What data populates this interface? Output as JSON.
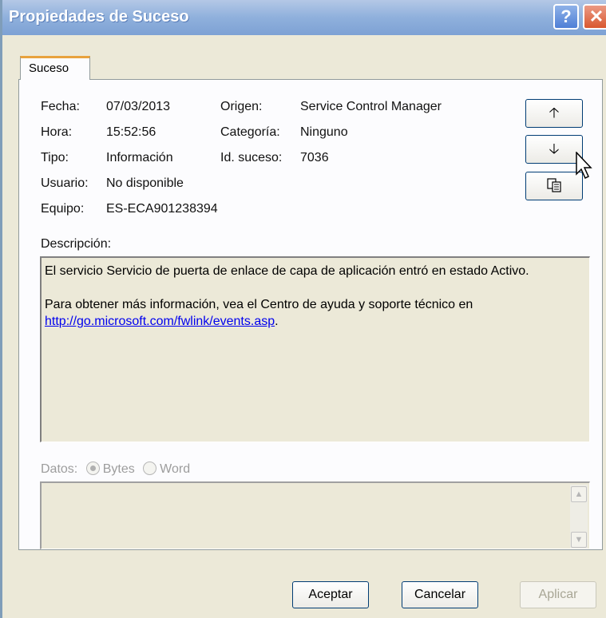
{
  "window": {
    "title": "Propiedades de Suceso",
    "help_label": "?",
    "close_label": "✕"
  },
  "tabs": [
    {
      "label": "Suceso"
    }
  ],
  "event": {
    "fecha_label": "Fecha:",
    "fecha": "07/03/2013",
    "hora_label": "Hora:",
    "hora": "15:52:56",
    "tipo_label": "Tipo:",
    "tipo": "Información",
    "usuario_label": "Usuario:",
    "usuario": "No disponible",
    "equipo_label": "Equipo:",
    "equipo": "ES-ECA901238394",
    "origen_label": "Origen:",
    "origen": "Service Control Manager",
    "categoria_label": "Categoría:",
    "categoria": "Ninguno",
    "id_label": "Id. suceso:",
    "id": "7036"
  },
  "side_buttons": {
    "up_icon": "arrow-up-icon",
    "down_icon": "arrow-down-icon",
    "copy_icon": "copy-icon"
  },
  "description": {
    "label": "Descripción:",
    "paragraph1": "El servicio Servicio de puerta de enlace de capa de aplicación entró en estado Activo.",
    "paragraph2": "Para obtener más información, vea el Centro de ayuda y soporte técnico en",
    "link": "http://go.microsoft.com/fwlink/events.asp",
    "after_link": "."
  },
  "data_section": {
    "label": "Datos:",
    "option_bytes": "Bytes",
    "option_word": "Word",
    "selected": "Bytes"
  },
  "buttons": {
    "ok": "Aceptar",
    "cancel": "Cancelar",
    "apply": "Aplicar"
  }
}
